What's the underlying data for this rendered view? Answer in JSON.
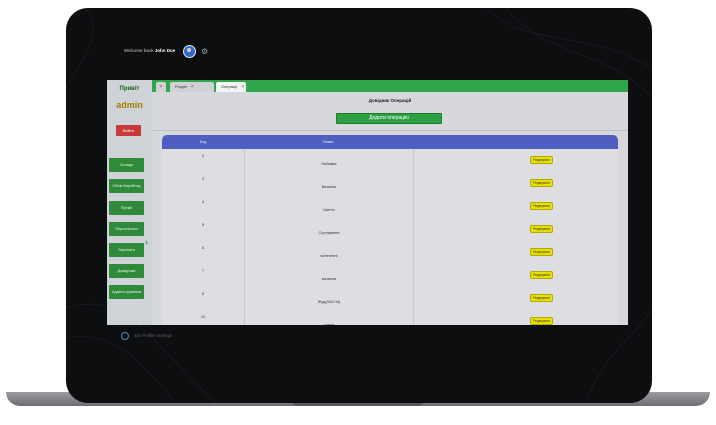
{
  "header": {
    "welcome_text": "Welcome back",
    "user_name": "John Doe"
  },
  "sidebar": {
    "greeting": "Привіт",
    "username": "admin",
    "logout_label": "Вийти",
    "items": [
      {
        "label": "Склади"
      },
      {
        "label": "Облік Виробітку"
      },
      {
        "label": "Премії"
      },
      {
        "label": "Персональні"
      },
      {
        "label": "Зарплата"
      },
      {
        "label": "Довідники"
      },
      {
        "label": "Адміністрування"
      }
    ]
  },
  "tabs": [
    {
      "label": "Розділ"
    },
    {
      "label": "Операції"
    }
  ],
  "main": {
    "title": "Довідник Операцій",
    "add_button": "Додати операцію"
  },
  "table": {
    "headers": [
      "Код",
      "Назва",
      ""
    ],
    "edit_label": "Редагувати",
    "rows": [
      {
        "id": "2",
        "name": "Набивка"
      },
      {
        "id": "3",
        "name": "Вязання"
      },
      {
        "id": "4",
        "name": "Шиття"
      },
      {
        "id": "5",
        "name": "Сортування"
      },
      {
        "id": "6",
        "name": "в/ілетевні"
      },
      {
        "id": "7",
        "name": "вязання"
      },
      {
        "id": "8",
        "name": "Жуд(ЛАСЧ4)"
      },
      {
        "id": "10",
        "name": "шиття"
      }
    ]
  },
  "footer": {
    "settings_label": "Set Profile Settings"
  },
  "colors": {
    "accent_green": "#2f8a3a",
    "header_blue": "#4f5fbf",
    "logout_red": "#c83a3a",
    "edit_yellow": "#e8e000"
  }
}
